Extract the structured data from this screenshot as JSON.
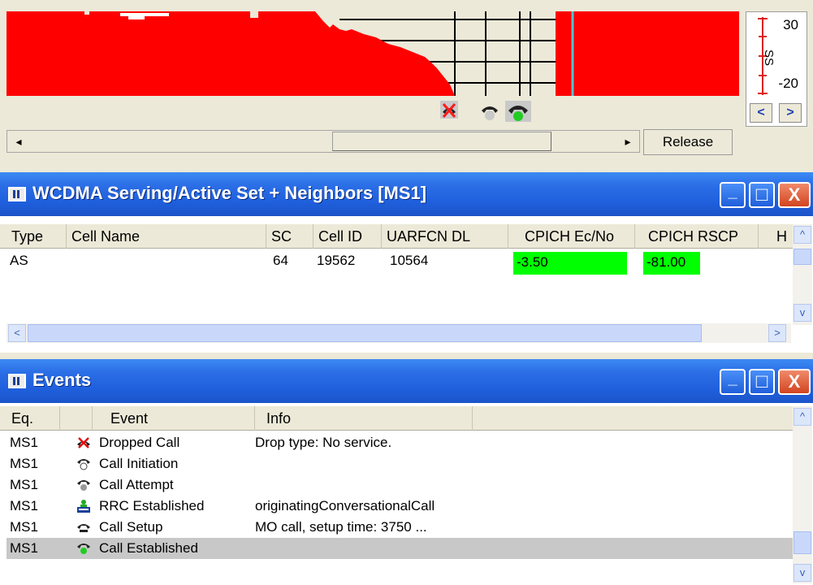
{
  "top_panel": {
    "scale": {
      "top": "30",
      "label": "SS",
      "bottom": "-20"
    },
    "scroll_left": "◂",
    "scroll_right": "▸",
    "release_label": "Release",
    "nav_left": "<",
    "nav_right": ">"
  },
  "wcdma": {
    "title": "WCDMA Serving/Active Set + Neighbors [MS1]",
    "columns": [
      "Type",
      "Cell Name",
      "SC",
      "Cell ID",
      "UARFCN DL",
      "CPICH Ec/No",
      "CPICH RSCP",
      "H"
    ],
    "rows": [
      {
        "type": "AS",
        "cell_name": "",
        "sc": "64",
        "cell_id": "19562",
        "uarfcn": "10564",
        "ecno": "-3.50",
        "rscp": "-81.00",
        "highlight_color": "#00ff00"
      }
    ]
  },
  "events": {
    "title": "Events",
    "columns": [
      "Eq.",
      "Event",
      "Info"
    ],
    "rows": [
      {
        "eq": "MS1",
        "icon": "dropped-call-icon",
        "event": "Dropped Call",
        "info": "Drop type: No service."
      },
      {
        "eq": "MS1",
        "icon": "call-initiation-icon",
        "event": "Call Initiation",
        "info": ""
      },
      {
        "eq": "MS1",
        "icon": "call-attempt-icon",
        "event": "Call Attempt",
        "info": ""
      },
      {
        "eq": "MS1",
        "icon": "rrc-established-icon",
        "event": "RRC Established",
        "info": "originatingConversationalCall"
      },
      {
        "eq": "MS1",
        "icon": "call-setup-icon",
        "event": "Call Setup",
        "info": "MO call, setup time: 3750 ..."
      },
      {
        "eq": "MS1",
        "icon": "call-established-icon",
        "event": "Call Established",
        "info": "",
        "selected": true
      }
    ]
  },
  "window_buttons": {
    "minimize": "_",
    "maximize": "□",
    "close": "X"
  },
  "colors": {
    "signal_red": "#ff0000",
    "titlebar_blue": "#1f5fdc",
    "highlight_green": "#00ff00",
    "marker_cyan": "#4fc3d8"
  }
}
